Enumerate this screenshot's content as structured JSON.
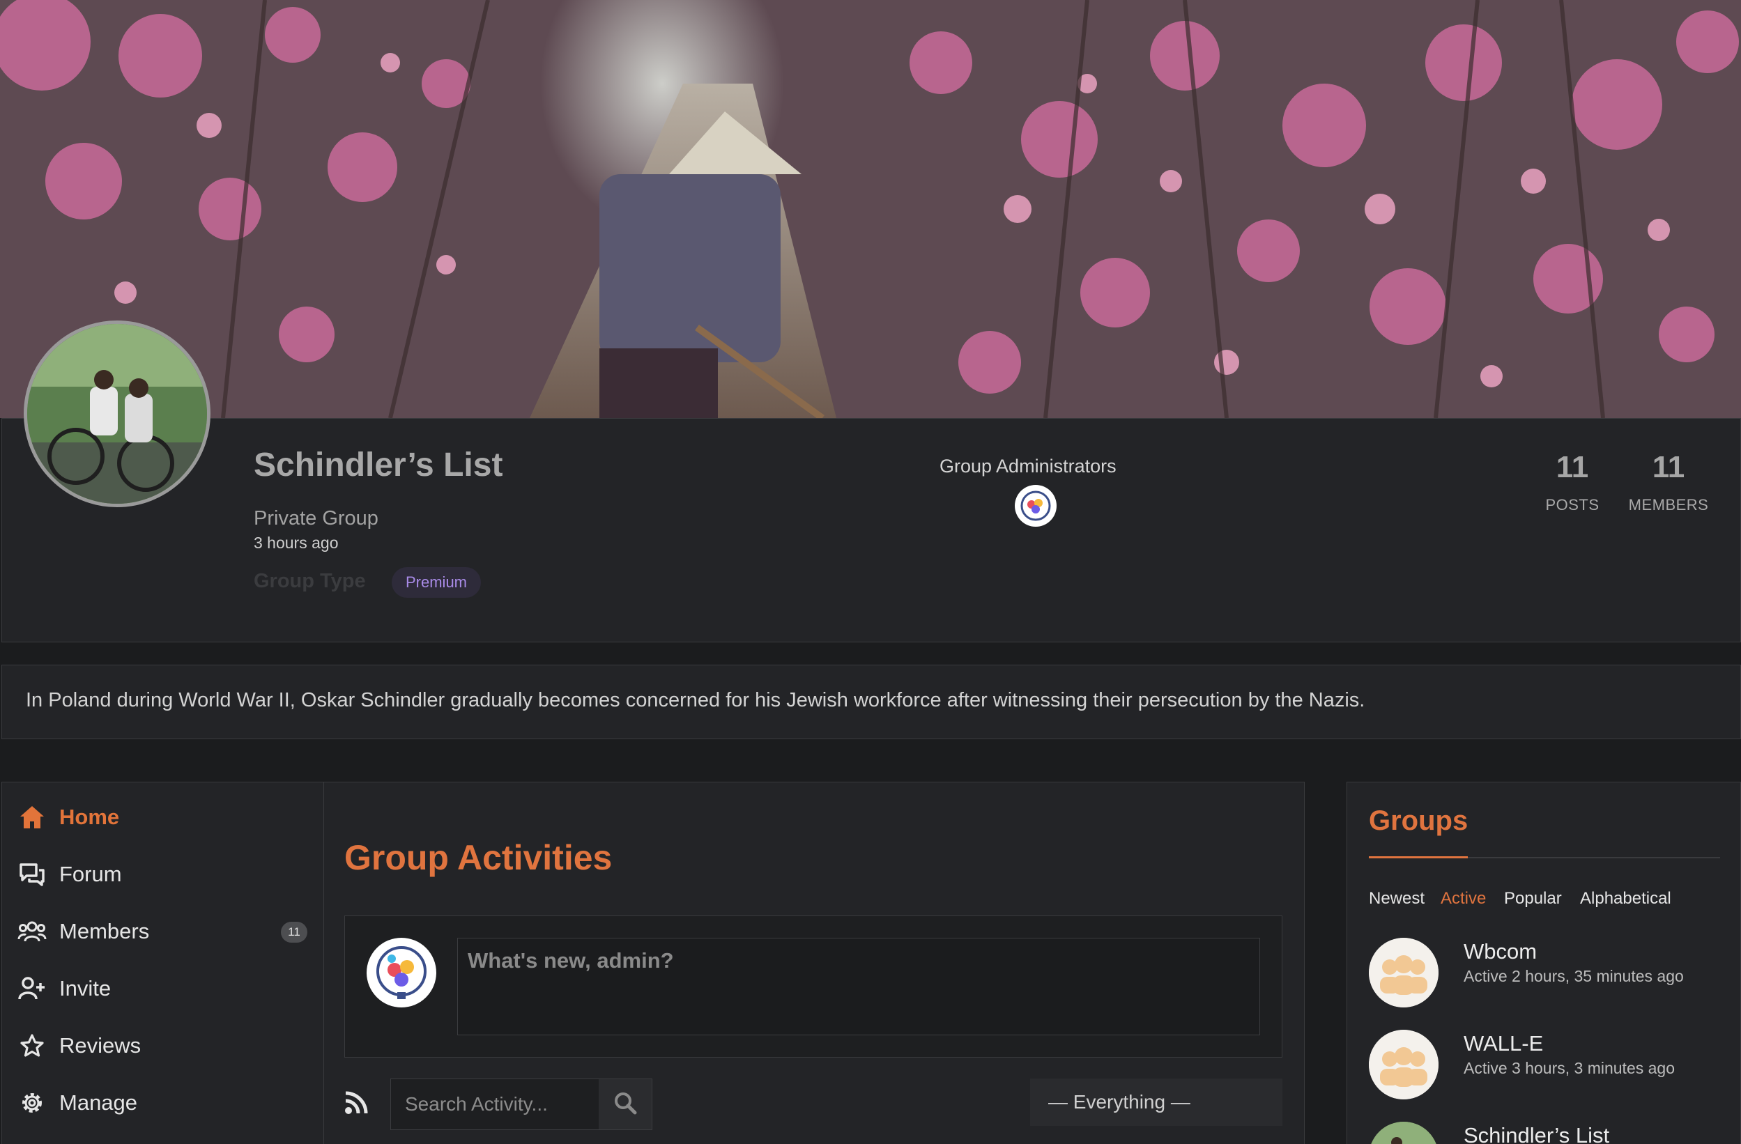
{
  "group": {
    "title": "Schindler’s List",
    "status": "Private Group",
    "created": "3 hours ago",
    "type_label": "Group Type",
    "type_value": "Premium",
    "admins_label": "Group Administrators",
    "description": "In Poland during World War II, Oskar Schindler gradually becomes concerned for his Jewish workforce after witnessing their persecution by the Nazis."
  },
  "stats": {
    "posts": {
      "value": "11",
      "label": "POSTS"
    },
    "members": {
      "value": "11",
      "label": "MEMBERS"
    }
  },
  "nav": {
    "items": [
      {
        "label": "Home",
        "icon": "home-icon",
        "active": true
      },
      {
        "label": "Forum",
        "icon": "chat-bubbles-icon",
        "active": false
      },
      {
        "label": "Members",
        "icon": "members-icon",
        "active": false,
        "count": "11"
      },
      {
        "label": "Invite",
        "icon": "user-plus-icon",
        "active": false
      },
      {
        "label": "Reviews",
        "icon": "star-icon",
        "active": false
      },
      {
        "label": "Manage",
        "icon": "gear-icon",
        "active": false
      }
    ]
  },
  "main": {
    "title": "Group Activities",
    "post_placeholder": "What's new, admin?",
    "search_placeholder": "Search Activity...",
    "filter_value": "— Everything —"
  },
  "sidebar": {
    "title": "Groups",
    "tabs": [
      "Newest",
      "Active",
      "Popular",
      "Alphabetical"
    ],
    "active_tab": "Active",
    "groups": [
      {
        "name": "Wbcom",
        "meta": "Active 2 hours, 35 minutes ago"
      },
      {
        "name": "WALL-E",
        "meta": "Active 3 hours, 3 minutes ago"
      },
      {
        "name": "Schindler’s List",
        "meta": ""
      }
    ]
  },
  "colors": {
    "accent": "#e0743f",
    "premium": "#a98be8",
    "background": "#1b1c1e",
    "panel": "#232427"
  }
}
